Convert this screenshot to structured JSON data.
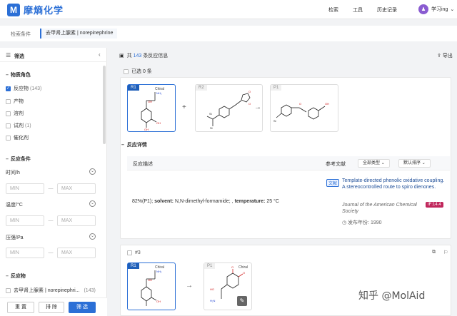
{
  "header": {
    "logo_text": "摩熵化学",
    "nav": [
      "检索",
      "工具",
      "历史记录"
    ],
    "user": "学习ing"
  },
  "conditions": {
    "label": "检索条件",
    "chip": "去甲肾上腺素 | norepinephrine"
  },
  "sidebar": {
    "title": "筛选",
    "role_section": "物质角色",
    "roles": [
      {
        "label": "反应物",
        "count": "(143)",
        "checked": true
      },
      {
        "label": "产物",
        "count": "",
        "checked": false
      },
      {
        "label": "溶剂",
        "count": "",
        "checked": false
      },
      {
        "label": "试剂",
        "count": "(1)",
        "checked": false
      },
      {
        "label": "催化剂",
        "count": "",
        "checked": false
      }
    ],
    "conditions_section": "反应条件",
    "filters": [
      {
        "label": "时间/h",
        "min": "MIN",
        "max": "MAX"
      },
      {
        "label": "温度/°C",
        "min": "MIN",
        "max": "MAX"
      },
      {
        "label": "压强/Pa",
        "min": "MIN",
        "max": "MAX"
      }
    ],
    "reactant_section": "反应物",
    "reactant_item": {
      "label": "去甲肾上腺素 | norepinephri...",
      "count": "(143)"
    },
    "buttons": {
      "reset": "重 置",
      "exclude": "排 除",
      "filter": "筛 选"
    }
  },
  "results": {
    "prefix": "共",
    "count": "143",
    "suffix": "条反应信息",
    "export": "导出",
    "selected": "已选 0 条"
  },
  "reaction1": {
    "tags": [
      "R1",
      "R2",
      "P1"
    ],
    "chiral": "Chiral",
    "plus": "+",
    "arrow": "→",
    "details_label": "反应详情",
    "col_desc": "反应描述",
    "col_ref": "参考文献",
    "dd_type": "全部类型",
    "dd_sort": "默认排序",
    "desc_yield": "82%(P1);",
    "desc_solvent_key": "solvent:",
    "desc_solvent_val": "N,N-dimethyl-formamide; ,",
    "desc_temp_key": "temperature:",
    "desc_temp_val": "25 °C",
    "ref_badge": "文献",
    "ref_title": "Template-directed phenolic oxidative coupling. A stereocontrolled route to spiro dienones.",
    "ref_journal": "Journal of the American Chemical Society",
    "ref_if": "IF:14.4",
    "ref_year_label": "发布年份:",
    "ref_year": "1990"
  },
  "reaction2": {
    "number": "#3",
    "tags": [
      "R1",
      "P1"
    ],
    "chiral": "Chiral",
    "arrow": "→"
  },
  "watermark": "知乎 @MolAid",
  "colors": {
    "brand": "#2b6fd6",
    "if_badge": "#c0265b"
  }
}
